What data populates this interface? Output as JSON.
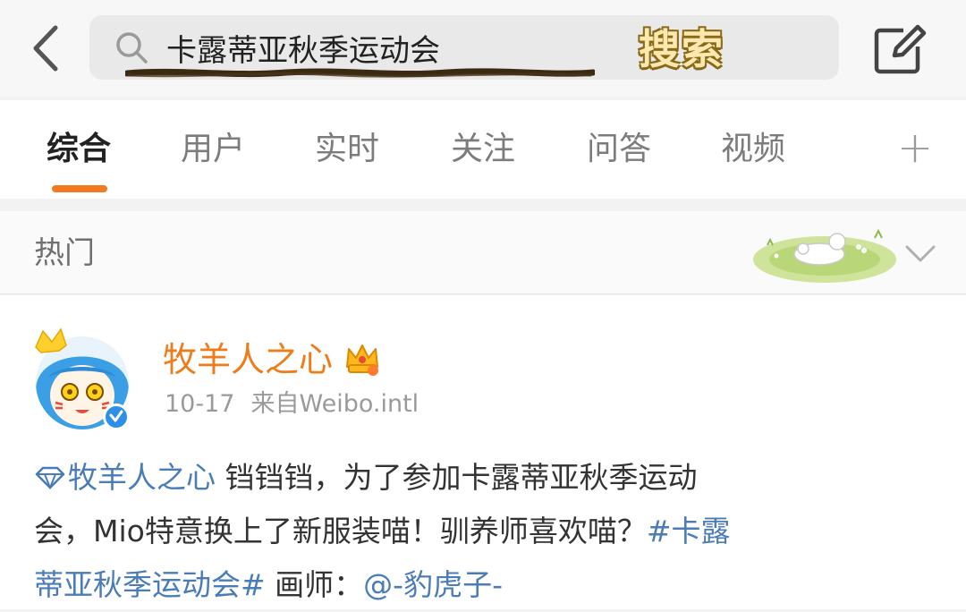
{
  "header": {
    "search_query": "卡露蒂亚秋季运动会",
    "search_button_label": "搜索"
  },
  "tabs": [
    {
      "label": "综合",
      "active": true
    },
    {
      "label": "用户",
      "active": false
    },
    {
      "label": "实时",
      "active": false
    },
    {
      "label": "关注",
      "active": false
    },
    {
      "label": "问答",
      "active": false
    },
    {
      "label": "视频",
      "active": false
    }
  ],
  "tab_add_label": "+",
  "hot": {
    "label": "热门"
  },
  "post": {
    "username": "牧羊人之心",
    "date": "10-17",
    "source": "来自Weibo.intl",
    "body": {
      "mention_self": "牧羊人之心",
      "line1_text": " 铛铛铛，为了参加卡露蒂亚秋季运动",
      "line2_text": "会，Mio特意换上了新服装喵！驯养师喜欢喵？",
      "hashtag_part1": "#卡露",
      "hashtag_part2": "蒂亚秋季运动会#",
      "painter_label": " 画师：",
      "painter_mention": "@-豹虎子-"
    }
  },
  "colors": {
    "accent_orange": "#f27b22",
    "username_orange": "#ef7c1a",
    "link_blue": "#4a7cb8"
  },
  "icons": {
    "back": "back-arrow-icon",
    "search": "search-icon",
    "compose": "compose-icon",
    "chevron": "chevron-down-icon",
    "vip": "vip-crown-icon",
    "verified": "verified-badge-icon",
    "diamond": "diamond-icon"
  }
}
